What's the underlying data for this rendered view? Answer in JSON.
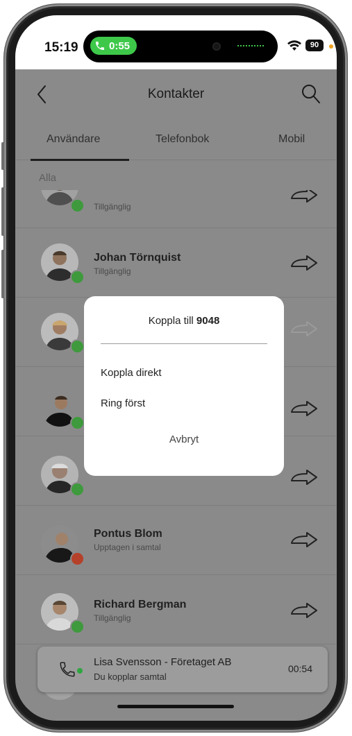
{
  "status_bar": {
    "time": "15:19",
    "call_timer": "0:55",
    "battery": "90"
  },
  "header": {
    "title": "Kontakter"
  },
  "tabs": [
    {
      "label": "Användare",
      "active": true
    },
    {
      "label": "Telefonbok",
      "active": false
    },
    {
      "label": "Mobil",
      "active": false
    }
  ],
  "section_label": "Alla",
  "contacts": [
    {
      "name": "",
      "status": "Tillgänglig",
      "status_color": "#3e9a3c"
    },
    {
      "name": "Johan Törnquist",
      "status": "Tillgänglig",
      "status_color": "#3e9a3c"
    },
    {
      "name": "",
      "status": "",
      "status_color": "#3e9a3c"
    },
    {
      "name": "",
      "status": "",
      "status_color": "#3e9a3c"
    },
    {
      "name": "",
      "status": "",
      "status_color": "#3e9a3c"
    },
    {
      "name": "Pontus Blom",
      "status": "Upptagen i samtal",
      "status_color": "#b5412a"
    },
    {
      "name": "Richard Bergman",
      "status": "Tillgänglig",
      "status_color": "#3e9a3c"
    }
  ],
  "dialog": {
    "title_prefix": "Koppla till",
    "number": "9048",
    "options": [
      "Koppla direkt",
      "Ring först"
    ],
    "cancel": "Avbryt"
  },
  "active_call": {
    "name": "Lisa Svensson - Företaget AB",
    "status": "Du kopplar samtal",
    "duration": "00:54"
  },
  "icons": {
    "back": "chevron-left-icon",
    "search": "search-icon",
    "transfer": "transfer-arrow-icon",
    "call": "phone-icon"
  }
}
